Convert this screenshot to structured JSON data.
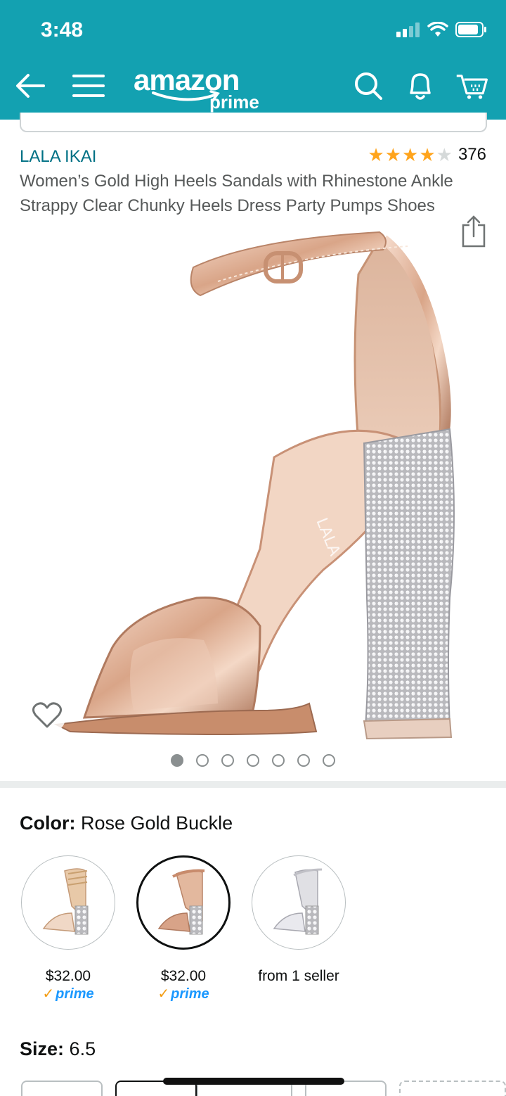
{
  "status_bar": {
    "time": "3:48"
  },
  "header": {
    "logo_word": "amazon",
    "logo_prime": "prime",
    "icons": [
      "back-arrow-icon",
      "menu-icon",
      "search-icon",
      "bell-icon",
      "cart-icon"
    ],
    "bar_color": "#13a1b1"
  },
  "product": {
    "brand": "LALA IKAI",
    "rating_stars": 4,
    "rating_count": "376",
    "title": "Women’s Gold High Heels Sandals with Rhinestone Ankle Strappy Clear Chunky Heels Dress Party Pumps Shoes",
    "image_count": 7,
    "active_image": 1
  },
  "color": {
    "label": "Color:",
    "value": "Rose Gold Buckle",
    "swatches": [
      {
        "price": "$32.00",
        "prime": "prime",
        "selected": false
      },
      {
        "price": "$32.00",
        "prime": "prime",
        "selected": true
      },
      {
        "price": "from 1 seller",
        "prime": "",
        "selected": false
      }
    ]
  },
  "size": {
    "label": "Size:",
    "value": "6.5"
  }
}
